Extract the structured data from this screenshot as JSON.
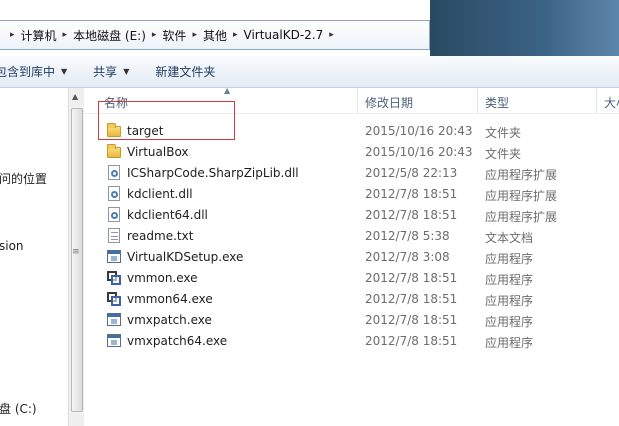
{
  "breadcrumb": {
    "items": [
      "计算机",
      "本地磁盘 (E:)",
      "软件",
      "其他",
      "VirtualKD-2.7"
    ]
  },
  "title_area": {
    "ghost_text_1": "",
    "ghost_text_2": ""
  },
  "toolbar": {
    "include_label": "包含到库中",
    "share_label": "共享",
    "new_folder_label": "新建文件夹"
  },
  "nav": {
    "items": [
      "问的位置",
      "sion",
      "盘 (C:)"
    ]
  },
  "columns": {
    "name": "名称",
    "date": "修改日期",
    "type": "类型",
    "size": "大小"
  },
  "files": [
    {
      "name": "target",
      "date": "2015/10/16 20:43",
      "type": "文件夹",
      "icon": "folder-icon"
    },
    {
      "name": "VirtualBox",
      "date": "2015/10/16 20:43",
      "type": "文件夹",
      "icon": "folder-icon"
    },
    {
      "name": "ICSharpCode.SharpZipLib.dll",
      "date": "2012/5/8 22:13",
      "type": "应用程序扩展",
      "icon": "dll-icon"
    },
    {
      "name": "kdclient.dll",
      "date": "2012/7/8 18:51",
      "type": "应用程序扩展",
      "icon": "dll-icon"
    },
    {
      "name": "kdclient64.dll",
      "date": "2012/7/8 18:51",
      "type": "应用程序扩展",
      "icon": "dll-icon"
    },
    {
      "name": "readme.txt",
      "date": "2012/7/8 5:38",
      "type": "文本文档",
      "icon": "text-file-icon"
    },
    {
      "name": "VirtualKDSetup.exe",
      "date": "2012/7/8 3:08",
      "type": "应用程序",
      "icon": "exe-icon"
    },
    {
      "name": "vmmon.exe",
      "date": "2012/7/8 18:51",
      "type": "应用程序",
      "icon": "vmmon-icon"
    },
    {
      "name": "vmmon64.exe",
      "date": "2012/7/8 18:51",
      "type": "应用程序",
      "icon": "vmmon-icon"
    },
    {
      "name": "vmxpatch.exe",
      "date": "2012/7/8 18:51",
      "type": "应用程序",
      "icon": "exe-icon"
    },
    {
      "name": "vmxpatch64.exe",
      "date": "2012/7/8 18:51",
      "type": "应用程序",
      "icon": "exe-icon"
    }
  ],
  "colors": {
    "highlight_box": "#d23b3b",
    "address_border": "#8ea4c1",
    "toolbar_text": "#1e3a5f"
  }
}
